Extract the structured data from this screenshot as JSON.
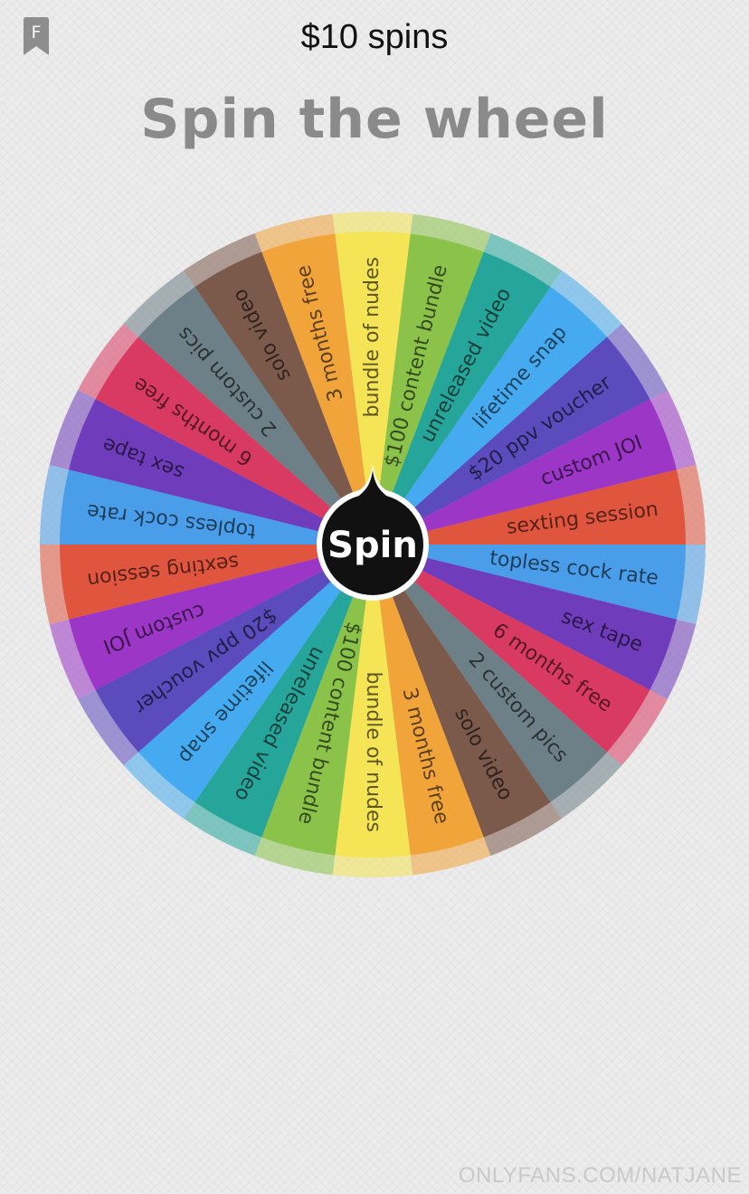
{
  "header": {
    "title": "$10 spins",
    "bookmark_letter": "F"
  },
  "heading": "Spin the wheel",
  "wheel": {
    "spin_label": "Spin",
    "segments": [
      {
        "label": "bundle of nudes",
        "color": "#f5e455"
      },
      {
        "label": "$100 content bundle",
        "color": "#8bc34a"
      },
      {
        "label": "unreleased video",
        "color": "#26a69a"
      },
      {
        "label": "lifetime snap",
        "color": "#45aaef"
      },
      {
        "label": "$20 ppv voucher",
        "color": "#5c4bbd"
      },
      {
        "label": "custom JOI",
        "color": "#9b36c6"
      },
      {
        "label": "sexting session",
        "color": "#e0553e"
      },
      {
        "label": "topless cock rate",
        "color": "#4a9de8"
      },
      {
        "label": "sex tape",
        "color": "#6f3dbb"
      },
      {
        "label": "6 months free",
        "color": "#d93a62"
      },
      {
        "label": "2 custom pics",
        "color": "#6e8087"
      },
      {
        "label": "solo video",
        "color": "#7b5a4c"
      },
      {
        "label": "3 months free",
        "color": "#f0a43a"
      },
      {
        "label": "bundle of nudes",
        "color": "#f5e455"
      },
      {
        "label": "$100 content bundle",
        "color": "#8bc34a"
      },
      {
        "label": "unreleased video",
        "color": "#26a69a"
      },
      {
        "label": "lifetime snap",
        "color": "#45aaef"
      },
      {
        "label": "$20 ppv voucher",
        "color": "#5c4bbd"
      },
      {
        "label": "custom JOI",
        "color": "#9b36c6"
      },
      {
        "label": "sexting session",
        "color": "#e0553e"
      },
      {
        "label": "topless cock rate",
        "color": "#4a9de8"
      },
      {
        "label": "sex tape",
        "color": "#6f3dbb"
      },
      {
        "label": "6 months free",
        "color": "#d93a62"
      },
      {
        "label": "2 custom pics",
        "color": "#6e8087"
      },
      {
        "label": "solo video",
        "color": "#7b5a4c"
      },
      {
        "label": "3 months free",
        "color": "#f0a43a"
      }
    ]
  },
  "watermark": "ONLYFANS.COM/NATJANE"
}
